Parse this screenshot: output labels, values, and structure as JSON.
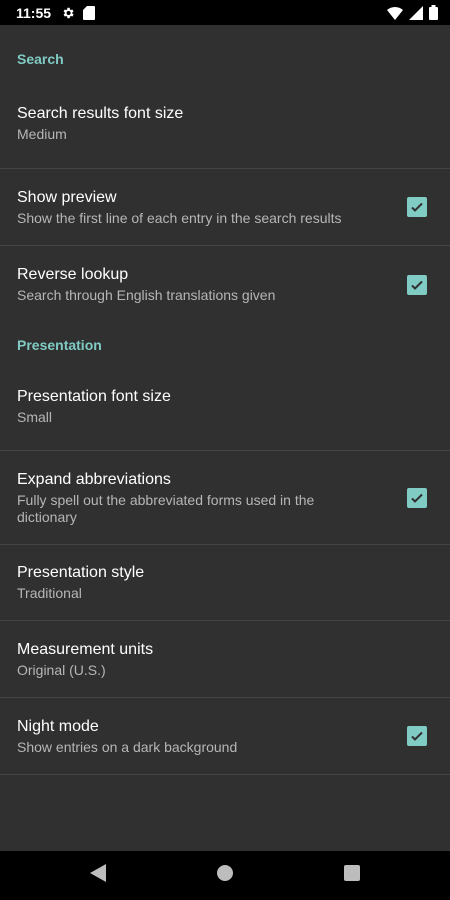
{
  "status_bar": {
    "time": "11:55",
    "left_icons": [
      "gear-icon",
      "sd-card-icon"
    ],
    "right_icons": [
      "wifi-icon",
      "signal-icon",
      "battery-icon"
    ]
  },
  "sections": [
    {
      "header": "Search",
      "items": [
        {
          "title": "Search results font size",
          "summary": "Medium",
          "checkbox": false
        },
        {
          "title": "Show preview",
          "summary": "Show the first line of each entry in the search results",
          "checkbox": true,
          "checked": true
        },
        {
          "title": "Reverse lookup",
          "summary": "Search through English translations given",
          "checkbox": true,
          "checked": true
        }
      ]
    },
    {
      "header": "Presentation",
      "items": [
        {
          "title": "Presentation font size",
          "summary": "Small",
          "checkbox": false
        },
        {
          "title": "Expand abbreviations",
          "summary": "Fully spell out the abbreviated forms used in the dictionary",
          "checkbox": true,
          "checked": true
        },
        {
          "title": "Presentation style",
          "summary": "Traditional",
          "checkbox": false
        },
        {
          "title": "Measurement units",
          "summary": "Original (U.S.)",
          "checkbox": false
        },
        {
          "title": "Night mode",
          "summary": "Show entries on a dark background",
          "checkbox": true,
          "checked": true
        }
      ]
    }
  ],
  "nav_bar": {
    "buttons": [
      "back-icon",
      "home-icon",
      "recents-icon"
    ]
  },
  "colors": {
    "accent": "#80cbc4",
    "background": "#303030",
    "divider": "#444444",
    "summary_text": "#b6b6b6"
  }
}
